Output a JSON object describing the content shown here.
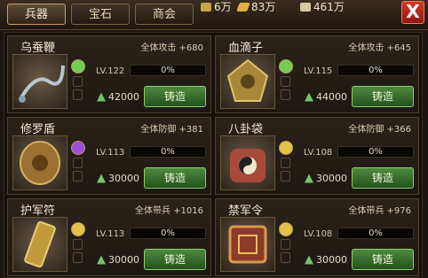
{
  "tabs": [
    {
      "label": "兵器",
      "active": true
    },
    {
      "label": "宝石",
      "active": false
    },
    {
      "label": "商会",
      "active": false
    }
  ],
  "resources": [
    {
      "value": "6万",
      "color": "#c9a34a",
      "icon": "silver-icon"
    },
    {
      "value": "83万",
      "color": "#e0b040",
      "icon": "gold-bar-icon"
    },
    {
      "value": "461万",
      "color": "#d7c8a0",
      "icon": "wood-icon"
    }
  ],
  "close_label": "X",
  "items": [
    {
      "name": "乌蚕鞭",
      "stat": "全体攻击 +680",
      "level": "LV.122",
      "progress_label": "0%",
      "progress": 0.0,
      "cost": "42000",
      "forge_label": "铸造",
      "gem_color": "#6fcf52",
      "art_icon": "whip-icon"
    },
    {
      "name": "血滴子",
      "stat": "全体攻击 +645",
      "level": "LV.115",
      "progress_label": "0%",
      "progress": 0.0,
      "cost": "44000",
      "forge_label": "铸造",
      "gem_color": "#6fcf52",
      "art_icon": "blood-drop-weapon-icon"
    },
    {
      "name": "修罗盾",
      "stat": "全体防御 +381",
      "level": "LV.113",
      "progress_label": "0%",
      "progress": 0.0,
      "cost": "30000",
      "forge_label": "铸造",
      "gem_color": "#a04fd8",
      "art_icon": "shield-icon"
    },
    {
      "name": "八卦袋",
      "stat": "全体防御 +366",
      "level": "LV.108",
      "progress_label": "0%",
      "progress": 0.0,
      "cost": "30000",
      "forge_label": "铸造",
      "gem_color": "#e2c24a",
      "art_icon": "bagua-bag-icon"
    },
    {
      "name": "护军符",
      "stat": "全体带兵 +1016",
      "level": "LV.113",
      "progress_label": "0%",
      "progress": 0.0,
      "cost": "30000",
      "forge_label": "铸造",
      "gem_color": "#e2c24a",
      "art_icon": "tally-icon"
    },
    {
      "name": "禁军令",
      "stat": "全体带兵 +976",
      "level": "LV.108",
      "progress_label": "0%",
      "progress": 0.0,
      "cost": "30000",
      "forge_label": "铸造",
      "gem_color": "#e2c24a",
      "art_icon": "token-icon"
    }
  ]
}
